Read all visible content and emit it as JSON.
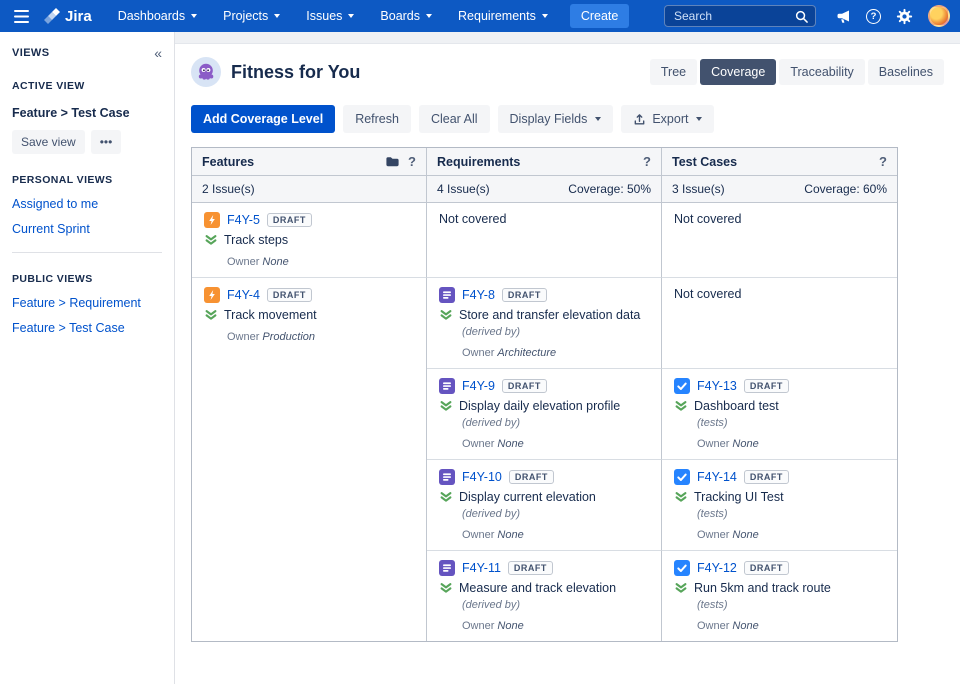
{
  "topnav": {
    "brand": "Jira",
    "menus": [
      {
        "label": "Dashboards"
      },
      {
        "label": "Projects"
      },
      {
        "label": "Issues"
      },
      {
        "label": "Boards"
      },
      {
        "label": "Requirements"
      }
    ],
    "create_label": "Create",
    "search": {
      "placeholder": "Search"
    }
  },
  "glyphs": {
    "help": "?",
    "collapse_left": "«",
    "more": "•••"
  },
  "sidebar": {
    "title": "VIEWS",
    "active_view_heading": "ACTIVE VIEW",
    "active_view": "Feature > Test Case",
    "save_view_label": "Save view",
    "personal_heading": "PERSONAL VIEWS",
    "personal_links": [
      {
        "label": "Assigned to me"
      },
      {
        "label": "Current Sprint"
      }
    ],
    "public_heading": "PUBLIC VIEWS",
    "public_links": [
      {
        "label": "Feature > Requirement"
      },
      {
        "label": "Feature > Test Case"
      }
    ]
  },
  "header": {
    "title": "Fitness for You",
    "tabs": [
      {
        "label": "Tree"
      },
      {
        "label": "Coverage"
      },
      {
        "label": "Traceability"
      },
      {
        "label": "Baselines"
      }
    ]
  },
  "toolbar": {
    "add_coverage": "Add Coverage Level",
    "refresh": "Refresh",
    "clear_all": "Clear All",
    "display_fields": "Display Fields",
    "export": "Export"
  },
  "table": {
    "columns": {
      "features": {
        "title": "Features",
        "count": "2 Issue(s)",
        "coverage": ""
      },
      "requirements": {
        "title": "Requirements",
        "count": "4 Issue(s)",
        "coverage": "Coverage: 50%"
      },
      "testcases": {
        "title": "Test Cases",
        "count": "3 Issue(s)",
        "coverage": "Coverage: 60%"
      }
    },
    "not_covered": "Not covered",
    "owner_label": "Owner",
    "rows": [
      {
        "feature": {
          "key": "F4Y-5",
          "badge": "DRAFT",
          "summary": "Track steps",
          "owner": "None"
        },
        "pairs": [
          {
            "req": {
              "not_covered": "Not covered"
            },
            "test": {
              "not_covered": "Not covered"
            }
          }
        ]
      },
      {
        "feature": {
          "key": "F4Y-4",
          "badge": "DRAFT",
          "summary": "Track movement",
          "owner": "Production"
        },
        "pairs": [
          {
            "req": {
              "key": "F4Y-8",
              "badge": "DRAFT",
              "summary": "Store and transfer elevation data",
              "relation": "(derived by)",
              "owner": "Architecture"
            },
            "test": {
              "not_covered": "Not covered"
            }
          },
          {
            "req": {
              "key": "F4Y-9",
              "badge": "DRAFT",
              "summary": "Display daily elevation profile",
              "relation": "(derived by)",
              "owner": "None"
            },
            "test": {
              "key": "F4Y-13",
              "badge": "DRAFT",
              "summary": "Dashboard test",
              "relation": "(tests)",
              "owner": "None"
            }
          },
          {
            "req": {
              "key": "F4Y-10",
              "badge": "DRAFT",
              "summary": "Display current elevation",
              "relation": "(derived by)",
              "owner": "None"
            },
            "test": {
              "key": "F4Y-14",
              "badge": "DRAFT",
              "summary": "Tracking UI Test",
              "relation": "(tests)",
              "owner": "None"
            }
          },
          {
            "req": {
              "key": "F4Y-11",
              "badge": "DRAFT",
              "summary": "Measure and track elevation",
              "relation": "(derived by)",
              "owner": "None"
            },
            "test": {
              "key": "F4Y-12",
              "badge": "DRAFT",
              "summary": "Run 5km and track route",
              "relation": "(tests)",
              "owner": "None"
            }
          }
        ]
      }
    ]
  },
  "colors": {
    "nav_bg": "#0d59c3",
    "create_btn": "#2e7de4",
    "link": "#0052cc",
    "primary_btn": "#0052cc",
    "tab_active_bg": "#42526e",
    "text_dark": "#172b4d",
    "text_gray": "#6b778c",
    "border": "#c1c7d0",
    "panel_bg": "#f4f5f7",
    "feature_icon": "#f79232",
    "requirement_icon": "#6554c0",
    "test_icon": "#2684ff",
    "priority_green": "#57a55a",
    "draft_text": "#42526e"
  }
}
